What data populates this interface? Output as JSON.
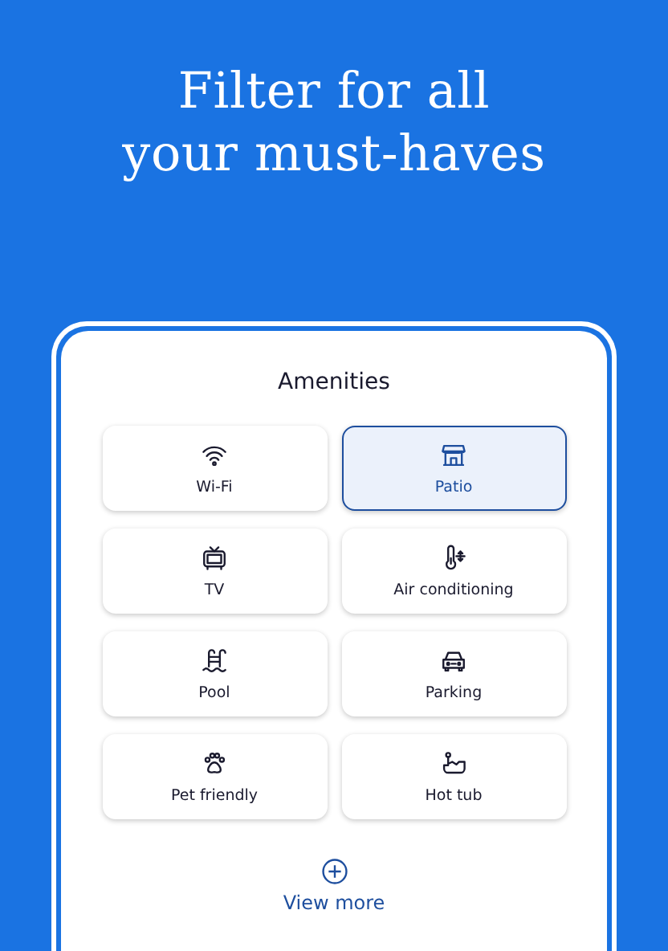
{
  "headline": [
    "Filter for all",
    "your must-haves"
  ],
  "panel": {
    "title": "Amenities",
    "amenities": [
      {
        "label": "Wi-Fi",
        "selected": false
      },
      {
        "label": "Patio",
        "selected": true
      },
      {
        "label": "TV",
        "selected": false
      },
      {
        "label": "Air conditioning",
        "selected": false
      },
      {
        "label": "Pool",
        "selected": false
      },
      {
        "label": "Parking",
        "selected": false
      },
      {
        "label": "Pet friendly",
        "selected": false
      },
      {
        "label": "Hot tub",
        "selected": false
      }
    ],
    "view_more": "View more"
  }
}
